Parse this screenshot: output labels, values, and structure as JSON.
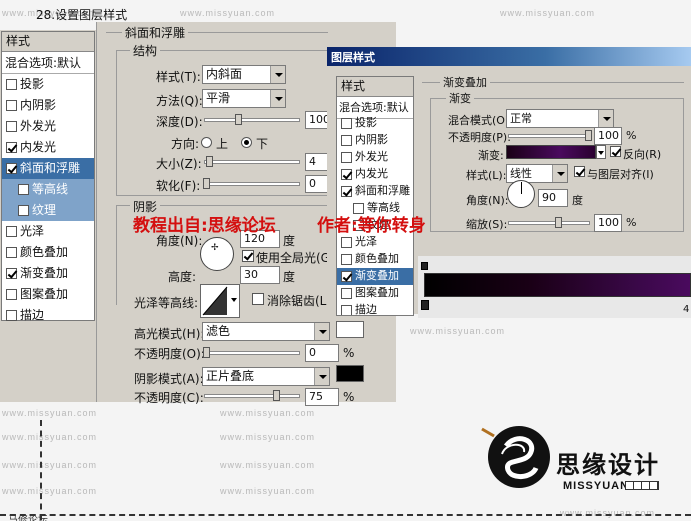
{
  "caption": "28.设置图层样式",
  "bottom_caption": "马修论坛",
  "watermark": "www.missyuan.com",
  "red_credit_left": "教程出自:思缘论坛",
  "red_credit_right": "作者:等你转身",
  "logo": {
    "cn": "思缘设计",
    "en": "MISSYUAN"
  },
  "left_list": {
    "header": "样式",
    "blend_default": "混合选项:默认",
    "items": [
      {
        "label": "投影",
        "checked": false
      },
      {
        "label": "内阴影",
        "checked": false
      },
      {
        "label": "外发光",
        "checked": false
      },
      {
        "label": "内发光",
        "checked": true
      },
      {
        "label": "斜面和浮雕",
        "checked": true
      },
      {
        "label": "等高线",
        "checked": false
      },
      {
        "label": "纹理",
        "checked": false
      },
      {
        "label": "光泽",
        "checked": false
      },
      {
        "label": "颜色叠加",
        "checked": false
      },
      {
        "label": "渐变叠加",
        "checked": true
      },
      {
        "label": "图案叠加",
        "checked": false
      },
      {
        "label": "描边",
        "checked": false
      }
    ]
  },
  "bevel": {
    "section": "斜面和浮雕",
    "structure": "结构",
    "style_label": "样式(T):",
    "style_value": "内斜面",
    "method_label": "方法(Q):",
    "method_value": "平滑",
    "depth_label": "深度(D):",
    "depth_value": "100",
    "direction_label": "方向:",
    "dir_up": "上",
    "dir_down": "下",
    "size_label": "大小(Z):",
    "size_value": "4",
    "soften_label": "软化(F):",
    "soften_value": "0",
    "shading": "阴影",
    "angle_label": "角度(N):",
    "angle_value": "120",
    "degree": "度",
    "global_light": "使用全局光(G)",
    "altitude_label": "高度:",
    "altitude_value": "30",
    "gloss_label": "光泽等高线:",
    "antialias": "消除锯齿(L)",
    "highlight_label": "高光模式(H):",
    "highlight_value": "滤色",
    "opacity1_label": "不透明度(O):",
    "opacity1_value": "0",
    "pct": "%",
    "shadow_label": "阴影模式(A):",
    "shadow_value": "正片叠底",
    "opacity2_label": "不透明度(C):",
    "opacity2_value": "75"
  },
  "dialog": {
    "title": "图层样式",
    "list_header": "样式",
    "blend_default": "混合选项:默认",
    "items": [
      {
        "label": "投影",
        "checked": false
      },
      {
        "label": "内阴影",
        "checked": false
      },
      {
        "label": "外发光",
        "checked": false
      },
      {
        "label": "内发光",
        "checked": true
      },
      {
        "label": "斜面和浮雕",
        "checked": true
      },
      {
        "label": "等高线",
        "checked": false
      },
      {
        "label": "纹理",
        "checked": false
      },
      {
        "label": "光泽",
        "checked": false
      },
      {
        "label": "颜色叠加",
        "checked": false
      },
      {
        "label": "渐变叠加",
        "checked": true
      },
      {
        "label": "图案叠加",
        "checked": false
      },
      {
        "label": "描边",
        "checked": false
      }
    ]
  },
  "gradient_overlay": {
    "section": "渐变叠加",
    "group": "渐变",
    "blend_label": "混合模式(O):",
    "blend_value": "正常",
    "opacity_label": "不透明度(P):",
    "opacity_value": "100",
    "pct": "%",
    "gradient_label": "渐变:",
    "reverse": "反向(R)",
    "style_label": "样式(L):",
    "style_value": "线性",
    "align": "与图层对齐(I)",
    "angle_label": "角度(N):",
    "angle_value": "90",
    "degree": "度",
    "scale_label": "缩放(S):",
    "scale_value": "100"
  },
  "gradient_editor": {
    "right_value": "4"
  },
  "colors": {
    "highlight": "#ffffff",
    "shadow": "#000000",
    "dialog_title": "#0a246a",
    "select": "#3a6ea5",
    "credit_red": "#d40f0f",
    "gradient_dark": "#1a0016",
    "gradient_purple": "#4a0a5e"
  }
}
